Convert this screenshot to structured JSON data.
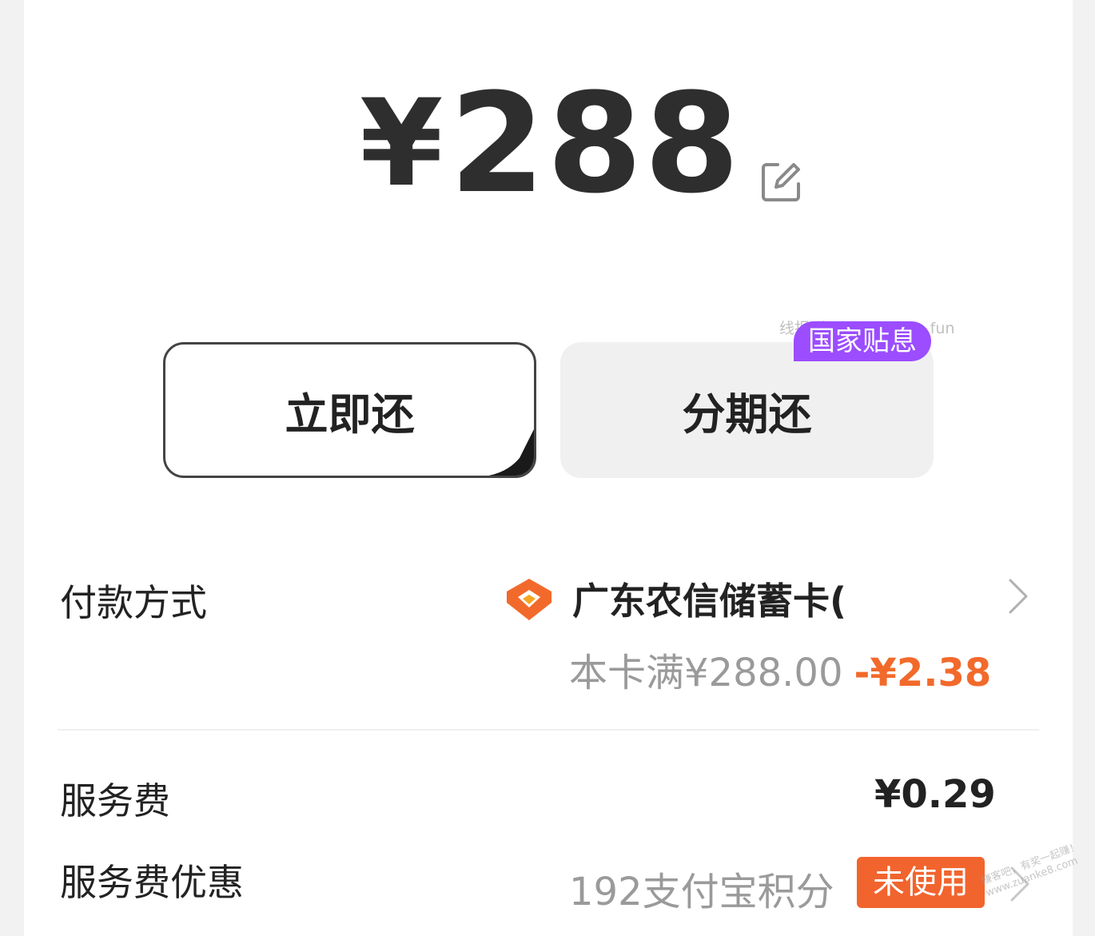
{
  "amount": {
    "currency": "¥",
    "value": "288",
    "edit_icon": "edit-icon"
  },
  "watermark": "线报群-new.xianbao.fun",
  "buttons": {
    "pay_now": "立即还",
    "installment": "分期还",
    "installment_badge": "国家贴息"
  },
  "payment": {
    "label": "付款方式",
    "bank_name": "广东农信储蓄卡(",
    "discount_text": "本卡满¥288.00",
    "discount_amount": "-¥2.38",
    "logo_color": "#f26a2b"
  },
  "service_fee": {
    "label": "服务费",
    "value": "¥0.29"
  },
  "fee_discount": {
    "label": "服务费优惠",
    "points": "192支付宝积分",
    "status": "未使用"
  },
  "corner_watermark": {
    "line1": "赚客吧，有奖一起赚！",
    "line2": "www.zuanke8.com"
  },
  "colors": {
    "accent_orange": "#f2642d",
    "badge_purple": "#9b4dff"
  }
}
